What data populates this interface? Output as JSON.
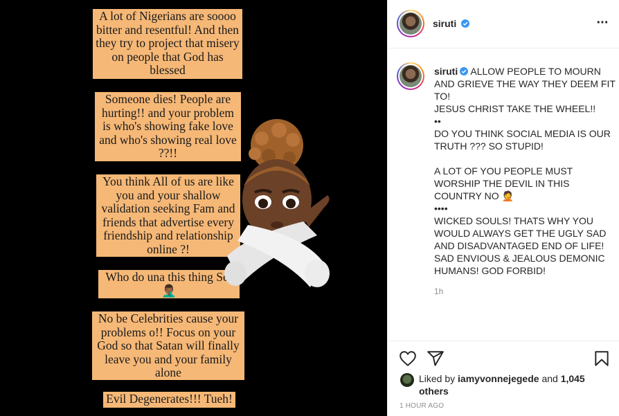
{
  "post": {
    "username": "siruti",
    "verified": true,
    "image_notes": [
      "A lot of Nigerians are soooo bitter and resentful! And then they try to project that misery on people that God has blessed",
      "Someone dies! People are hurting!!  and your problem is who's showing fake love and who's showing real love ??!!",
      "You think All of us are like you and your shallow validation seeking Fam and friends that advertise every friendship and relationship online ?!",
      "Who do una this thing Sef 🤦🏾‍♂️",
      "No be Celebrities cause your problems o!! Focus on your God so that Satan will finally leave you and your family alone",
      "Evil Degenerates!!! Tueh!"
    ],
    "caption_first": "ALLOW PEOPLE TO MOURN AND GRIEVE THE WAY THEY DEEM FIT TO!",
    "caption_rest": "JESUS CHRIST TAKE THE WHEEL!!\n••\nDO YOU THINK SOCIAL MEDIA IS OUR TRUTH ??? SO STUPID!\n\nA LOT OF YOU PEOPLE MUST WORSHIP THE DEVIL IN THIS COUNTRY NO 🤦\n••••\nWICKED SOULS! THATS WHY YOU WOULD ALWAYS GET THE UGLY SAD AND DISADVANTAGED END OF LIFE! SAD ENVIOUS & JEALOUS DEMONIC HUMANS! GOD FORBID!",
    "time_relative": "1h",
    "liked_by_prefix": "Liked by",
    "liked_by_user": "iamyvonnejegede",
    "liked_by_and": "and",
    "liked_by_others": "1,045 others",
    "time_absolute": "1 HOUR AGO"
  },
  "icons": {
    "more": "more-options-icon",
    "like": "heart-icon",
    "share": "paper-plane-icon",
    "save": "bookmark-icon",
    "verified": "verified-badge-icon"
  },
  "colors": {
    "note_bg": "#f6b877",
    "verified_blue": "#3897f0",
    "muted": "#8e8e8e"
  }
}
